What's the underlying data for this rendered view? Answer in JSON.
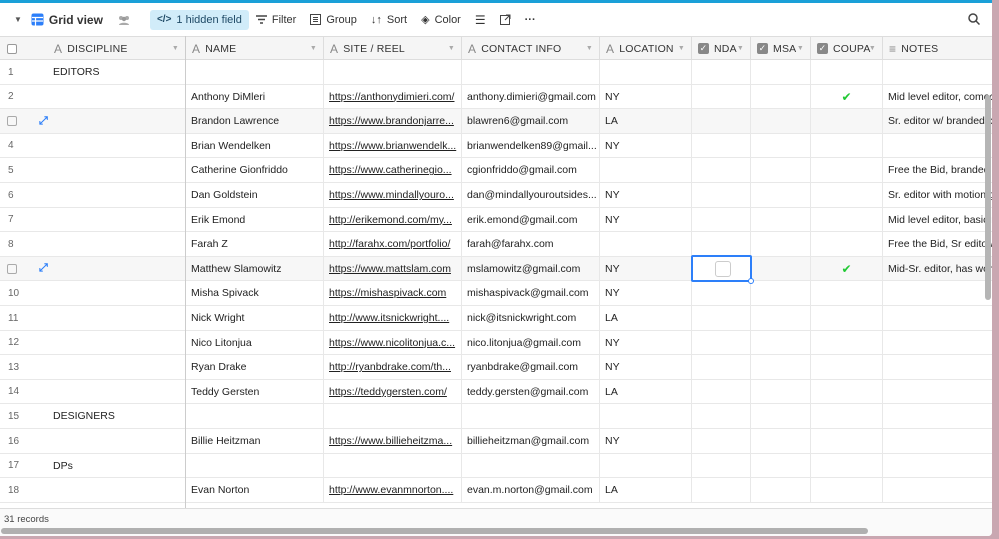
{
  "toolbar": {
    "view_name": "Grid view",
    "hidden_fields": "1 hidden field",
    "filter": "Filter",
    "group": "Group",
    "sort": "Sort",
    "color": "Color"
  },
  "columns": [
    {
      "label": "DISCIPLINE",
      "type": "text"
    },
    {
      "label": "NAME",
      "type": "text"
    },
    {
      "label": "SITE / REEL",
      "type": "text"
    },
    {
      "label": "CONTACT INFO",
      "type": "text"
    },
    {
      "label": "LOCATION",
      "type": "text"
    },
    {
      "label": "NDA",
      "type": "checkbox"
    },
    {
      "label": "MSA",
      "type": "checkbox"
    },
    {
      "label": "COUPA",
      "type": "checkbox"
    },
    {
      "label": "NOTES",
      "type": "long-text"
    }
  ],
  "rows": [
    {
      "n": "1",
      "discipline": "EDITORS",
      "name": "",
      "site": "",
      "contact": "",
      "location": "",
      "nda": false,
      "msa": false,
      "coupa": false,
      "notes": ""
    },
    {
      "n": "2",
      "discipline": "",
      "name": "Anthony DiMleri",
      "site": "https://anthonydimieri.com/",
      "contact": "anthony.dimieri@gmail.com",
      "location": "NY",
      "nda": false,
      "msa": false,
      "coupa": true,
      "notes": "Mid level editor, comed"
    },
    {
      "n": "",
      "hover": true,
      "discipline": "",
      "name": "Brandon Lawrence",
      "site": "https://www.brandonjarre...",
      "contact": "blawren6@gmail.com",
      "location": "LA",
      "nda": false,
      "msa": false,
      "coupa": false,
      "notes": "Sr. editor w/ branded co"
    },
    {
      "n": "4",
      "discipline": "",
      "name": "Brian Wendelken",
      "site": "https://www.brianwendelk...",
      "contact": "brianwendelken89@gmail...",
      "location": "NY",
      "nda": false,
      "msa": false,
      "coupa": false,
      "notes": ""
    },
    {
      "n": "5",
      "discipline": "",
      "name": "Catherine Gionfriddo",
      "site": "https://www.catherinegio...",
      "contact": "cgionfriddo@gmail.com",
      "location": "",
      "nda": false,
      "msa": false,
      "coupa": false,
      "notes": "Free the Bid, branded c"
    },
    {
      "n": "6",
      "discipline": "",
      "name": "Dan Goldstein",
      "site": "https://www.mindallyouro...",
      "contact": "dan@mindallyouroutsides...",
      "location": "NY",
      "nda": false,
      "msa": false,
      "coupa": false,
      "notes": "Sr. editor with motion g"
    },
    {
      "n": "7",
      "discipline": "",
      "name": "Erik Emond",
      "site": "http://erikemond.com/my...",
      "contact": "erik.emond@gmail.com",
      "location": "NY",
      "nda": false,
      "msa": false,
      "coupa": false,
      "notes": "Mid level editor, basic r"
    },
    {
      "n": "8",
      "discipline": "",
      "name": "Farah Z",
      "site": "http://farahx.com/portfolio/",
      "contact": "farah@farahx.com",
      "location": "",
      "nda": false,
      "msa": false,
      "coupa": false,
      "notes": "Free the Bid, Sr editor/c"
    },
    {
      "n": "",
      "hover": true,
      "discipline": "",
      "name": "Matthew Slamowitz",
      "site": "https://www.mattslam.com",
      "contact": "mslamowitz@gmail.com",
      "location": "NY",
      "nda": false,
      "msa": false,
      "coupa": true,
      "notes": "Mid-Sr. editor, has worl"
    },
    {
      "n": "10",
      "discipline": "",
      "name": "Misha Spivack",
      "site": "https://mishaspivack.com",
      "contact": "mishaspivack@gmail.com",
      "location": "NY",
      "nda": false,
      "msa": false,
      "coupa": false,
      "notes": ""
    },
    {
      "n": "11",
      "discipline": "",
      "name": "Nick Wright",
      "site": "http://www.itsnickwright....",
      "contact": "nick@itsnickwright.com",
      "location": "LA",
      "nda": false,
      "msa": false,
      "coupa": false,
      "notes": ""
    },
    {
      "n": "12",
      "discipline": "",
      "name": "Nico Litonjua",
      "site": "https://www.nicolitonjua.c...",
      "contact": "nico.litonjua@gmail.com",
      "location": "NY",
      "nda": false,
      "msa": false,
      "coupa": false,
      "notes": ""
    },
    {
      "n": "13",
      "discipline": "",
      "name": "Ryan Drake",
      "site": "http://ryanbdrake.com/th...",
      "contact": "ryanbdrake@gmail.com",
      "location": "NY",
      "nda": false,
      "msa": false,
      "coupa": false,
      "notes": ""
    },
    {
      "n": "14",
      "discipline": "",
      "name": "Teddy Gersten",
      "site": "https://teddygersten.com/",
      "contact": "teddy.gersten@gmail.com",
      "location": "LA",
      "nda": false,
      "msa": false,
      "coupa": false,
      "notes": ""
    },
    {
      "n": "15",
      "discipline": "DESIGNERS",
      "name": "",
      "site": "",
      "contact": "",
      "location": "",
      "nda": false,
      "msa": false,
      "coupa": false,
      "notes": ""
    },
    {
      "n": "16",
      "discipline": "",
      "name": "Billie Heitzman",
      "site": "https://www.billieheitzma...",
      "contact": "billieheitzman@gmail.com",
      "location": "NY",
      "nda": false,
      "msa": false,
      "coupa": false,
      "notes": ""
    },
    {
      "n": "17",
      "discipline": "DPs",
      "name": "",
      "site": "",
      "contact": "",
      "location": "",
      "nda": false,
      "msa": false,
      "coupa": false,
      "notes": ""
    },
    {
      "n": "18",
      "discipline": "",
      "name": "Evan Norton",
      "site": "http://www.evanmnorton....",
      "contact": "evan.m.norton@gmail.com",
      "location": "LA",
      "nda": false,
      "msa": false,
      "coupa": false,
      "notes": ""
    }
  ],
  "footer": {
    "records": "31 records"
  },
  "colors": {
    "accent": "#2d7ff9",
    "check": "#20c933",
    "hidden_bg": "#d1ecf9"
  }
}
